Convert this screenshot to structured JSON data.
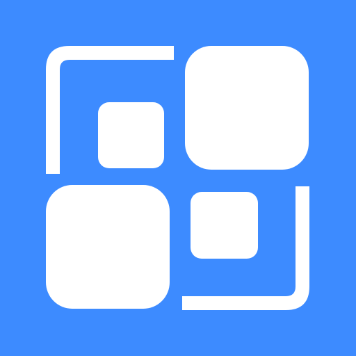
{
  "app_icon": {
    "icon_name": "qr-code-scanner-icon",
    "background_color": "#3d8bff",
    "foreground_color": "#ffffff"
  }
}
